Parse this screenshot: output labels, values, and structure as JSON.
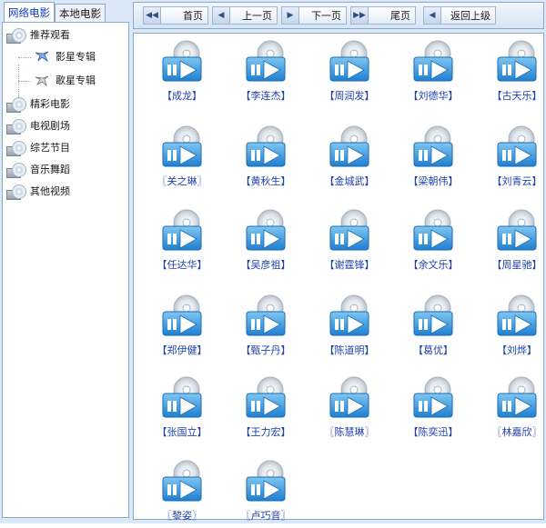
{
  "tabs": {
    "online": "网络电影",
    "local": "本地电影"
  },
  "tree": {
    "recommended": "推荐观看",
    "stars": "影星专辑",
    "singers": "歌星专辑",
    "featured": "精彩电影",
    "tv": "电视剧场",
    "variety": "综艺节目",
    "music": "音乐舞蹈",
    "other": "其他视频"
  },
  "toolbar": {
    "first": "首页",
    "prev": "上一页",
    "next": "下一页",
    "last": "尾页",
    "back": "返回上级"
  },
  "items": [
    "【成龙】",
    "【李连杰】",
    "【周润发】",
    "【刘德华】",
    "【古天乐】",
    "〖关之琳〗",
    "【黄秋生】",
    "【金城武】",
    "【梁朝伟】",
    "【刘青云】",
    "【任达华】",
    "【吴彦祖】",
    "【谢霆锋】",
    "【余文乐】",
    "【周星驰】",
    "【郑伊健】",
    "【甄子丹】",
    "【陈道明】",
    "【葛优】",
    "【刘烨】",
    "【张国立】",
    "【王力宏】",
    "〖陈慧琳〗",
    "【陈奕迅】",
    "〖林嘉欣〗",
    "〖黎姿〗",
    "〖卢巧音〗"
  ],
  "colors": {
    "accent": "#1540c8",
    "caption": "#1e3fae",
    "border": "#8aa8c8"
  }
}
